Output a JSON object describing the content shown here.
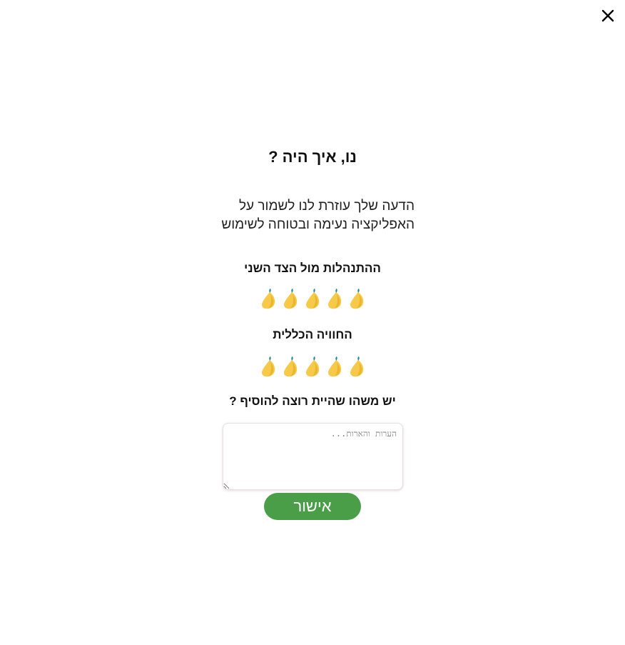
{
  "dialog": {
    "title": "נו, איך היה ?",
    "subtitle_line1": "הדעה שלך עוזרת לנו לשמור על",
    "subtitle_line2": "האפליקציה נעימה ובטוחה לשימוש"
  },
  "ratings": [
    {
      "label": "ההתנהלות מול הצד השני",
      "max": 5,
      "icon": "lemon-icon"
    },
    {
      "label": "החוויה הכללית",
      "max": 5,
      "icon": "lemon-icon"
    }
  ],
  "comments": {
    "question": "יש משהו שהיית רוצה להוסיף ?",
    "placeholder": "הערות והארות...",
    "value": ""
  },
  "confirm_label": "אישור",
  "colors": {
    "lemon": "#f7c948",
    "lemon_leaf": "#1f8a8a",
    "confirm_button": "#4a9e47",
    "text": "#111111"
  },
  "icons": {
    "close": "close-icon",
    "rating": "lemon-icon"
  }
}
